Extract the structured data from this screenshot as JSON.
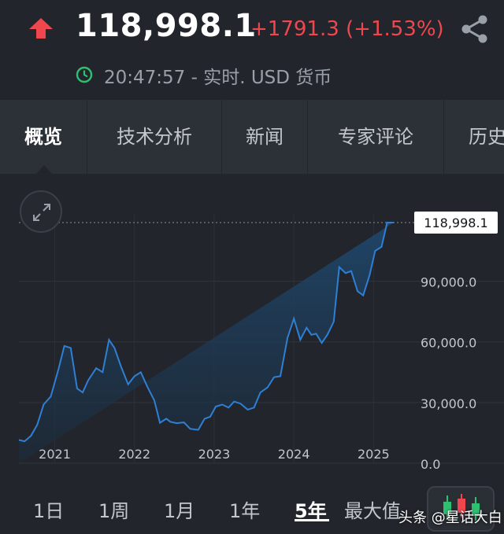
{
  "header": {
    "trend_icon": "arrow-up-icon",
    "price": "118,998.1",
    "change": "+1791.3 (+1.53%)",
    "time_line": "20:47:57 - 实时. USD 货币",
    "colors": {
      "down_up_red": "#f0474f",
      "clock_green": "#2fbf71"
    }
  },
  "tabs": [
    {
      "label": "概览",
      "active": true
    },
    {
      "label": "技术分析",
      "active": false
    },
    {
      "label": "新闻",
      "active": false
    },
    {
      "label": "专家评论",
      "active": false
    },
    {
      "label": "历史",
      "active": false
    }
  ],
  "chart_data": {
    "type": "area",
    "x": [
      2020.55,
      2020.62,
      2020.7,
      2020.78,
      2020.86,
      2020.95,
      2021.05,
      2021.12,
      2021.2,
      2021.28,
      2021.35,
      2021.42,
      2021.52,
      2021.6,
      2021.68,
      2021.75,
      2021.83,
      2021.92,
      2022.0,
      2022.08,
      2022.16,
      2022.25,
      2022.32,
      2022.4,
      2022.45,
      2022.53,
      2022.62,
      2022.7,
      2022.8,
      2022.88,
      2022.95,
      2023.02,
      2023.1,
      2023.18,
      2023.25,
      2023.33,
      2023.42,
      2023.5,
      2023.58,
      2023.67,
      2023.75,
      2023.83,
      2023.92,
      2024.0,
      2024.08,
      2024.16,
      2024.22,
      2024.28,
      2024.35,
      2024.42,
      2024.5,
      2024.57,
      2024.65,
      2024.72,
      2024.8,
      2024.87,
      2024.95,
      2025.02,
      2025.1,
      2025.17,
      2025.25,
      2025.32,
      2025.4,
      2025.48,
      2025.53
    ],
    "values": [
      11500,
      10800,
      13500,
      19000,
      29000,
      33000,
      47000,
      58000,
      57000,
      37000,
      35000,
      41000,
      47000,
      45000,
      61000,
      57000,
      48000,
      39000,
      43000,
      45000,
      38000,
      31000,
      20000,
      22000,
      20500,
      19800,
      20200,
      17000,
      16500,
      22000,
      23000,
      28000,
      29000,
      27500,
      30500,
      29500,
      26500,
      27500,
      35000,
      37500,
      42500,
      43000,
      62000,
      71500,
      61000,
      67000,
      63500,
      64000,
      59500,
      63500,
      70000,
      97000,
      94000,
      95000,
      85000,
      83000,
      93000,
      105000,
      107000,
      119000,
      118998.1
    ],
    "title": "",
    "xlabel": "",
    "ylabel": "",
    "x_ticks": [
      {
        "value": 2021.0,
        "label": "2021"
      },
      {
        "value": 2022.0,
        "label": "2022"
      },
      {
        "value": 2023.0,
        "label": "2023"
      },
      {
        "value": 2024.0,
        "label": "2024"
      },
      {
        "value": 2025.0,
        "label": "2025"
      }
    ],
    "y_ticks": [
      {
        "value": 0,
        "label": "0.0"
      },
      {
        "value": 30000,
        "label": "30,000.0"
      },
      {
        "value": 60000,
        "label": "60,000.0"
      },
      {
        "value": 90000,
        "label": "90,000.0"
      }
    ],
    "last_value_label": "118,998.1",
    "last_value": 118998.1,
    "xlim": [
      2020.55,
      2025.53
    ],
    "ylim": [
      0,
      118998.1
    ],
    "grid": true,
    "line_color": "#2f7fd4",
    "fill_color": "#1c3550"
  },
  "periods": [
    {
      "label": "1日",
      "active": false
    },
    {
      "label": "1周",
      "active": false
    },
    {
      "label": "1月",
      "active": false
    },
    {
      "label": "1年",
      "active": false
    },
    {
      "label": "5年",
      "active": true
    },
    {
      "label": "最大值",
      "active": false
    }
  ],
  "candle_button_icon": "candlestick-icon",
  "expand_icon": "expand-icon",
  "share_icon": "share-icon",
  "clock_icon": "clock-icon",
  "watermark": "头条 @星话大白"
}
